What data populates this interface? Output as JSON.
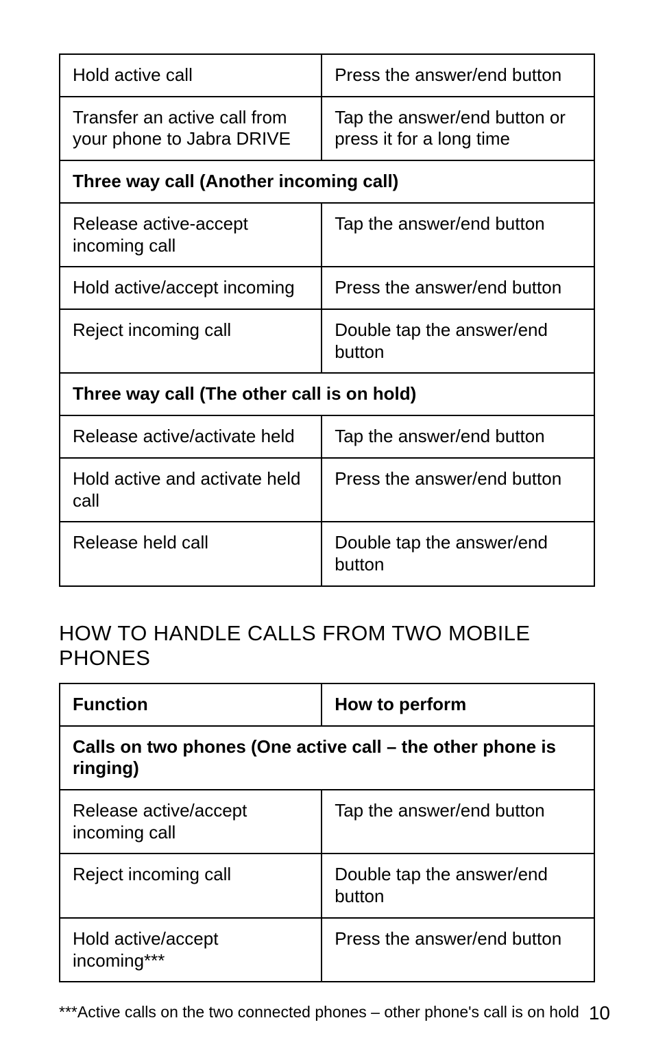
{
  "table1": {
    "rows": [
      {
        "left": "Hold active call",
        "right": "Press the answer/end button"
      },
      {
        "left": "Transfer an active call from your phone to Jabra DRIVE",
        "right": "Tap the answer/end button or press it for a long time"
      }
    ],
    "sectionA": "Three way call (Another incoming call)",
    "rowsA": [
      {
        "left": "Release active-accept incoming call",
        "right": "Tap the answer/end button"
      },
      {
        "left": "Hold active/accept incoming",
        "right": "Press the answer/end button"
      },
      {
        "left": "Reject incoming call",
        "right": "Double tap the answer/end button"
      }
    ],
    "sectionB": "Three way call (The other call is on hold)",
    "rowsB": [
      {
        "left": "Release active/activate held",
        "right": "Tap the answer/end button"
      },
      {
        "left": "Hold active and activate held call",
        "right": "Press the answer/end button"
      },
      {
        "left": "Release held call",
        "right": "Double tap the answer/end button"
      }
    ]
  },
  "heading2": "HOW TO HANDLE CALLS FROM TWO MOBILE PHONES",
  "table2": {
    "header": {
      "left": "Function",
      "right": "How to perform"
    },
    "section": "Calls on two phones (One active call – the other phone is ringing)",
    "rows": [
      {
        "left": "Release active/accept incoming call",
        "right": "Tap the answer/end button"
      },
      {
        "left": "Reject incoming call",
        "right": "Double tap the answer/end button"
      },
      {
        "left": "Hold active/accept incoming***",
        "right": "Press the answer/end button"
      }
    ]
  },
  "footnote": "***Active calls on the two connected phones – other phone's call is on hold",
  "pageNumber": "10"
}
